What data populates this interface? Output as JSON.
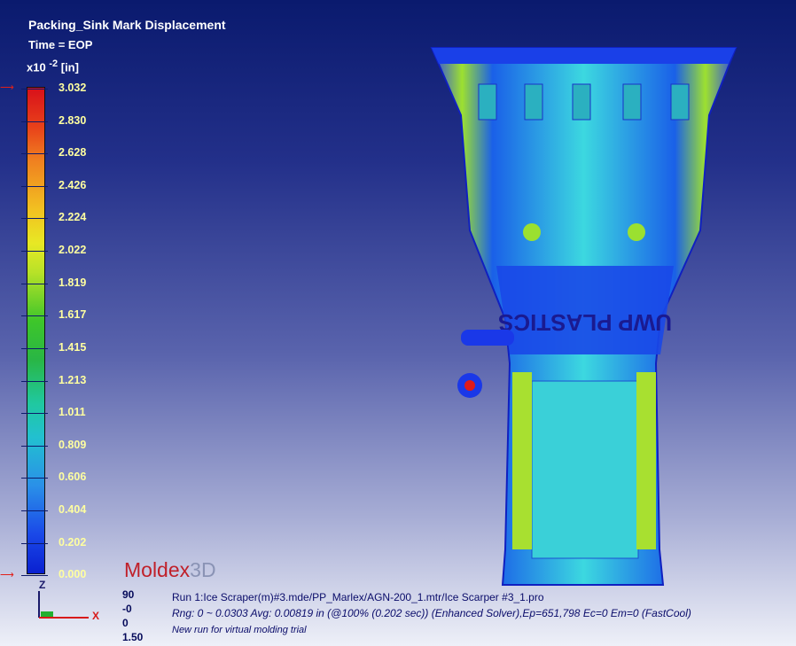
{
  "header": {
    "title": "Packing_Sink Mark Displacement",
    "time": "Time = EOP",
    "unit_prefix": "x10",
    "unit_exp": "-2",
    "unit": "[in]"
  },
  "legend": {
    "labels": [
      "3.032",
      "2.830",
      "2.628",
      "2.426",
      "2.224",
      "2.022",
      "1.819",
      "1.617",
      "1.415",
      "1.213",
      "1.011",
      "0.809",
      "0.606",
      "0.404",
      "0.202",
      "0.000"
    ]
  },
  "logo": {
    "part1": "Moldex",
    "part2": "3D"
  },
  "view": {
    "n1": "90",
    "n2": "-0",
    "n3": "0",
    "n4": "1.50"
  },
  "axes": {
    "z": "Z",
    "x": "X"
  },
  "footer": {
    "run": "Run 1:Ice Scraper(m)#3.mde/PP_Marlex/AGN-200_1.mtr/Ice Scarper #3_1.pro",
    "rng": "Rng: 0 ~ 0.0303   Avg: 0.00819 in  (@100% (0.202 sec)) (Enhanced Solver),Ep=651,798 Ec=0 Em=0 (FastCool)",
    "note": "New run for virtual molding trial"
  },
  "model": {
    "text": "UWP PLASTICS"
  }
}
